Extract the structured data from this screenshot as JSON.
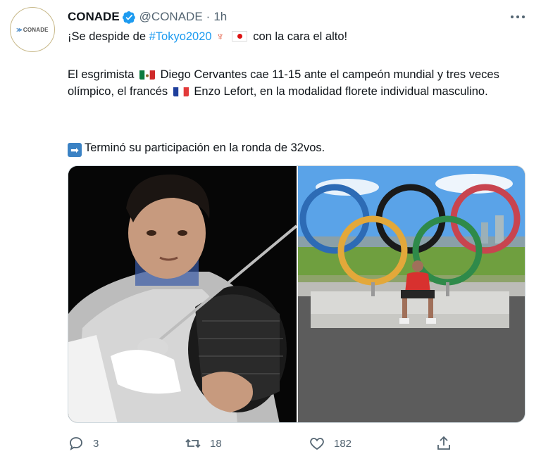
{
  "tweet": {
    "author_name": "CONADE",
    "author_handle": "@CONADE",
    "separator": "·",
    "time": "1h",
    "avatar_text": "CONADE",
    "line1_pre": "¡Se despide de ",
    "hashtag": "#Tokyo2020",
    "line1_post": "con la cara el alto!",
    "p2_a": "El esgrimista",
    "p2_b": "Diego Cervantes cae 11-15 ante el campeón mundial y tres veces olímpico, el francés",
    "p2_c": "Enzo Lefort, en la modalidad florete individual masculino.",
    "p3": "Terminó su participación en la ronda de 32vos."
  },
  "actions": {
    "replies": "3",
    "retweets": "18",
    "likes": "182"
  },
  "icons": {
    "verified": "verified-badge-icon",
    "more": "more-options-icon",
    "reply": "reply-icon",
    "retweet": "retweet-icon",
    "like": "heart-icon",
    "share": "share-icon"
  },
  "colors": {
    "accent": "#1d9bf0",
    "muted": "#536471"
  }
}
